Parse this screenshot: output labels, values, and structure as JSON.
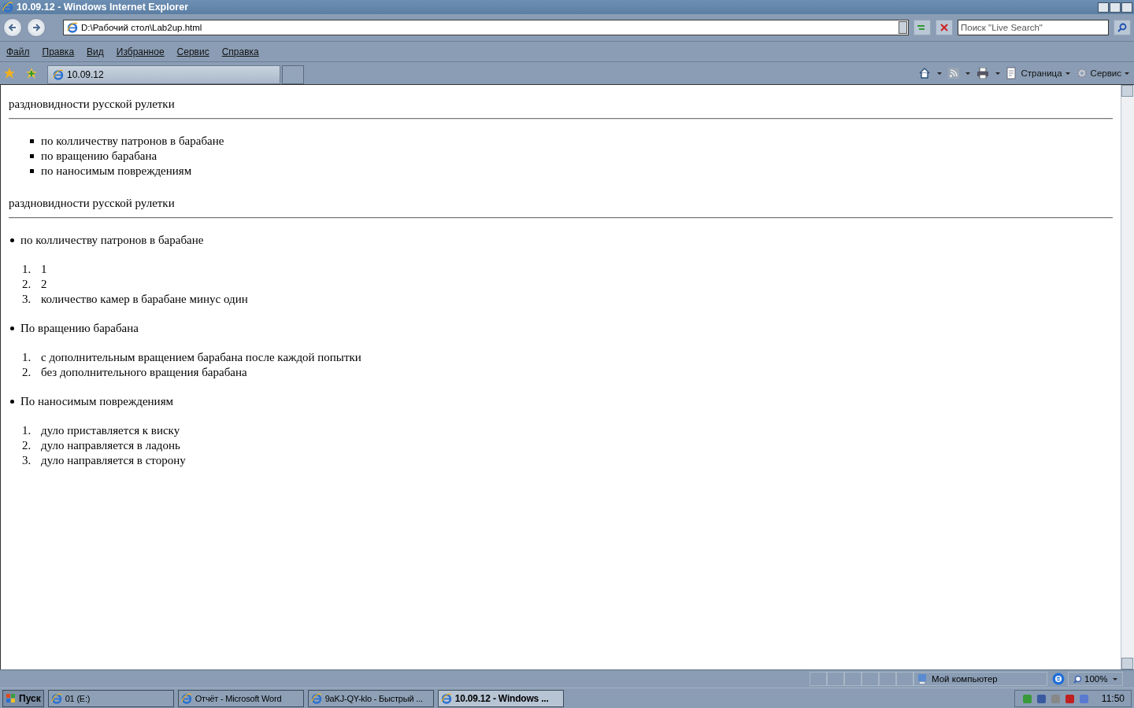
{
  "window": {
    "title": "10.09.12 - Windows Internet Explorer"
  },
  "address_bar": {
    "value": "D:\\Рабочий стол\\Lab2up.html"
  },
  "search": {
    "placeholder": "Поиск \"Live Search\""
  },
  "menu": [
    "Файл",
    "Правка",
    "Вид",
    "Избранное",
    "Сервис",
    "Справка"
  ],
  "tabs": [
    {
      "label": "10.09.12",
      "selected": true
    }
  ],
  "command_bar": [
    "Страница",
    "Сервис"
  ],
  "document": [
    {
      "heading": "раздновидности русской рулетки",
      "kind": "square",
      "items": [
        {
          "text": "по колличеству патронов в барабане"
        },
        {
          "text": "по вращению барабана"
        },
        {
          "text": "по наносимым повреждениям"
        }
      ]
    },
    {
      "heading": "раздновидности русской рулетки",
      "kind": "nested",
      "items": [
        {
          "text": "по колличеству патронов в барабане",
          "children": [
            {
              "number": "1.",
              "text": "1"
            },
            {
              "number": "2.",
              "text": "2"
            },
            {
              "number": "3.",
              "text": "количество камер в барабане минус один"
            }
          ]
        },
        {
          "text": "По вращению барабана",
          "children": [
            {
              "number": "1.",
              "text": "с дополнительным вращением барабана после каждой попытки"
            },
            {
              "number": "2.",
              "text": "без дополнительного вращения барабана"
            }
          ]
        },
        {
          "text": "По наносимым повреждениям",
          "children": [
            {
              "number": "1.",
              "text": "дуло приставляется к виску"
            },
            {
              "number": "2.",
              "text": "дуло направляется в ладонь"
            },
            {
              "number": "3.",
              "text": "дуло направляется в сторону"
            }
          ]
        }
      ]
    }
  ],
  "status_bar": {
    "zone": "Мой компьютер",
    "zoom": "100%"
  },
  "taskbar": {
    "start": "Пуск",
    "tasks": [
      {
        "label": "01 (E:)",
        "selected": false
      },
      {
        "label": "Отчёт  - Microsoft Word",
        "selected": false
      },
      {
        "label": "9aKJ-QY-klo - Быстрый ...",
        "selected": false
      },
      {
        "label": "10.09.12 - Windows ...",
        "selected": true
      }
    ],
    "clock": "11:50"
  }
}
